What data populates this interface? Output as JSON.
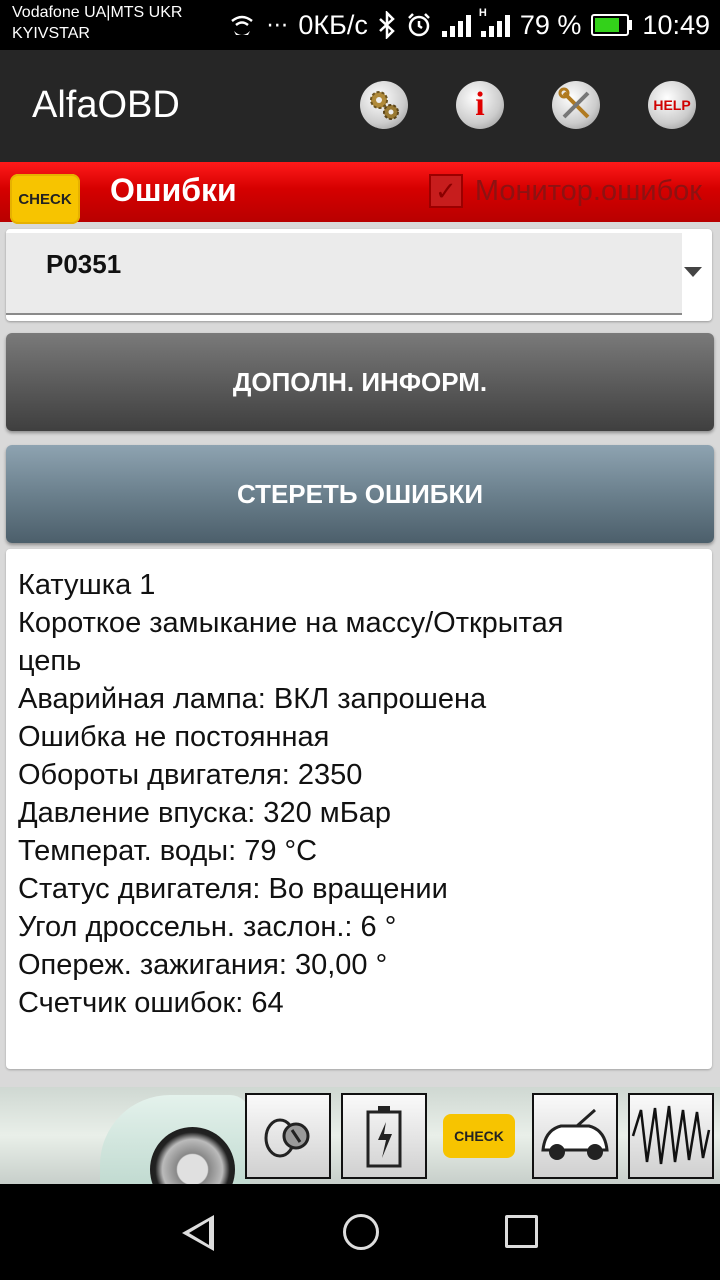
{
  "status_bar": {
    "carrier_line1": "Vodafone UA|MTS UKR",
    "carrier_line2": "KYIVSTAR",
    "data_speed": "0КБ/с",
    "battery_percent": "79 %",
    "time": "10:49",
    "icons": [
      "wifi-calling-icon",
      "more-icon",
      "bluetooth-icon",
      "alarm-icon",
      "signal-icon",
      "signal-h-icon",
      "battery-charging-icon"
    ]
  },
  "app_bar": {
    "title": "AlfaOBD",
    "buttons": [
      "settings-gears-icon",
      "info-icon",
      "tools-icon",
      "help-icon"
    ],
    "help_label": "HELP",
    "info_label": "i"
  },
  "section": {
    "badge": "CHECK",
    "title": "Ошибки",
    "monitor_label": "Монитор.ошибок",
    "monitor_checked": true
  },
  "spinner": {
    "selected": "P0351"
  },
  "buttons": {
    "more_info": "ДОПОЛН. ИНФОРМ.",
    "clear_errors": "СТЕРЕТЬ ОШИБКИ"
  },
  "details": {
    "lines": [
      "Катушка 1",
      "Короткое замыкание на массу/Открытая",
      "цепь",
      "Аварийная лампа: ВКЛ запрошена",
      "Ошибка не постоянная",
      "Обороты двигателя: 2350",
      "Давление впуска: 320 мБар",
      "Температ. воды: 79 °C",
      "Статус двигателя: Во вращении",
      "Угол дроссельн. заслон.: 6 °",
      "Опереж. зажигания: 30,00 °",
      "Счетчик ошибок: 64"
    ]
  },
  "toolbar": {
    "check_label": "CHECK",
    "tools": [
      "ignition-key-icon",
      "battery-icon",
      "check-engine-icon",
      "car-service-icon",
      "oscilloscope-icon"
    ]
  },
  "colors": {
    "accent_red": "#d50000",
    "check_yellow": "#f7c400",
    "charging_green": "#33d11a"
  }
}
